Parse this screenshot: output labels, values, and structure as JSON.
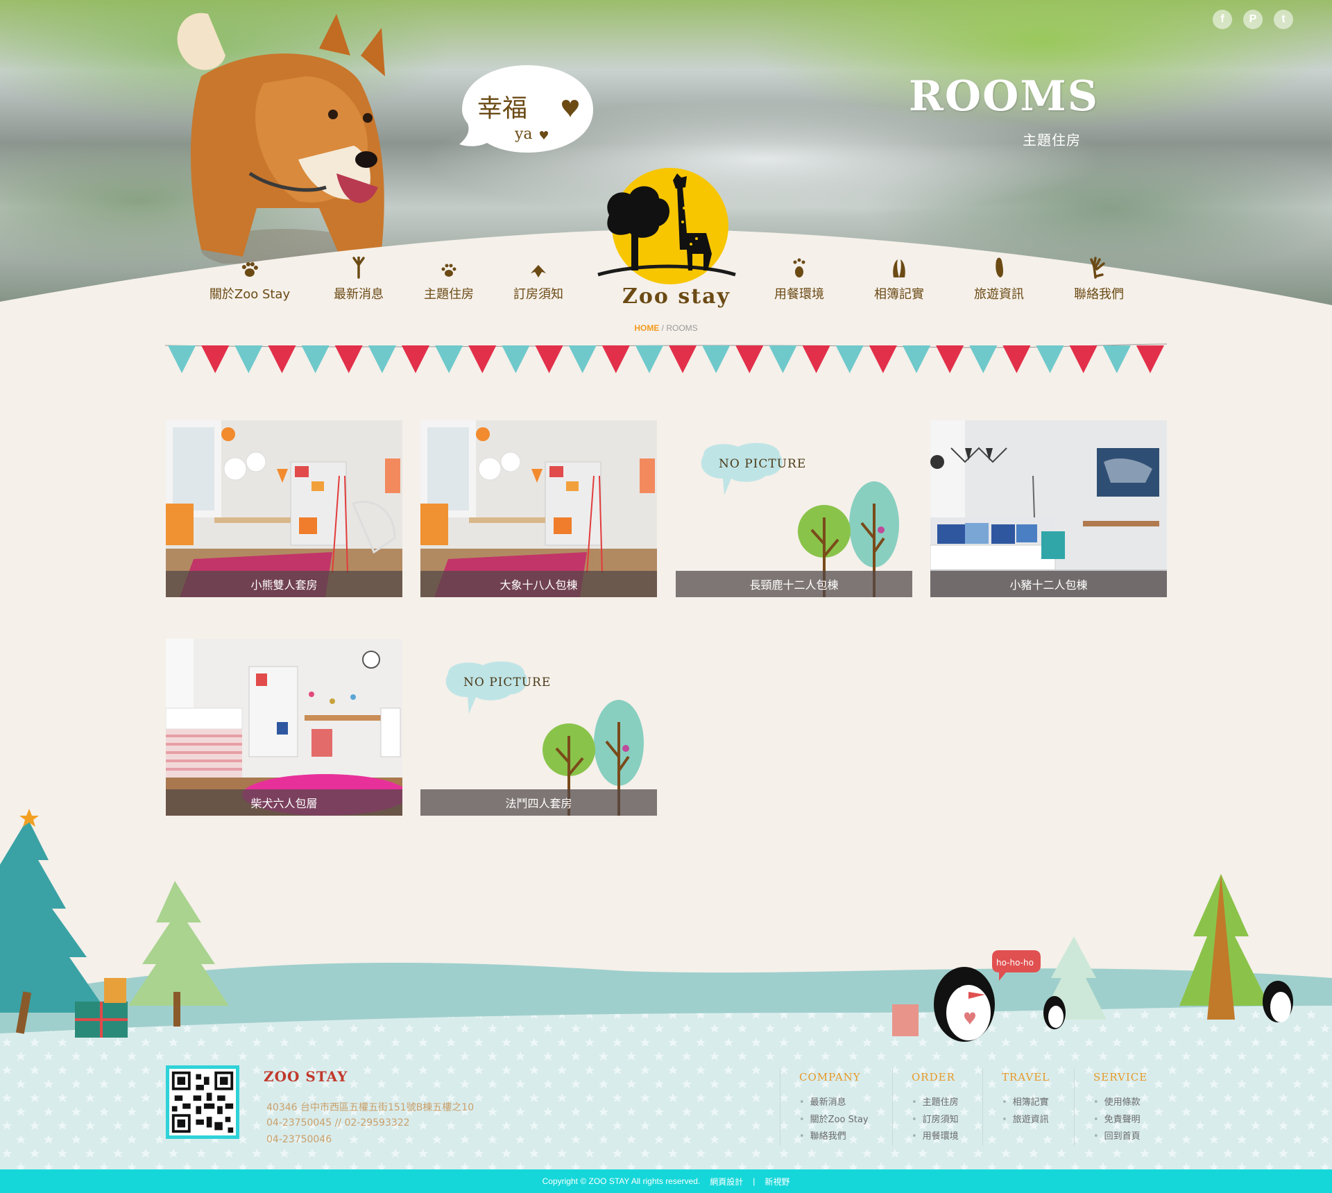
{
  "social": [
    {
      "name": "facebook",
      "icon": "f"
    },
    {
      "name": "plurk",
      "icon": "P"
    },
    {
      "name": "twitter",
      "icon": "t"
    }
  ],
  "hero": {
    "title": "ROOMS",
    "subtitle": "主題住房",
    "bubble_text_main": "幸福",
    "bubble_text_small": "ya"
  },
  "nav": {
    "items": [
      {
        "label": "關於Zoo Stay",
        "icon": "paw-icon"
      },
      {
        "label": "最新消息",
        "icon": "bird-foot-icon"
      },
      {
        "label": "主題住房",
        "icon": "cat-paw-icon"
      },
      {
        "label": "訂房須知",
        "icon": "duck-foot-icon"
      },
      {
        "label": "用餐環境",
        "icon": "bear-paw-icon"
      },
      {
        "label": "相簿記實",
        "icon": "hoof-icon"
      },
      {
        "label": "旅遊資訊",
        "icon": "footprint-icon"
      },
      {
        "label": "聯絡我們",
        "icon": "hand-paw-icon"
      }
    ],
    "logo_text": "Zoo stay"
  },
  "breadcrumb": {
    "home": "HOME",
    "separator": "/",
    "current": "ROOMS"
  },
  "rooms": [
    {
      "name": "小熊雙人套房",
      "image": "photo-bedroom-orange"
    },
    {
      "name": "大象十八人包棟",
      "image": "photo-bedroom-orange"
    },
    {
      "name": "長頸鹿十二人包棟",
      "image": "no-picture"
    },
    {
      "name": "小豬十二人包棟",
      "image": "photo-bedroom-blue"
    },
    {
      "name": "柴犬六人包層",
      "image": "photo-bedroom-pink"
    },
    {
      "name": "法鬥四人套房",
      "image": "no-picture"
    }
  ],
  "no_picture_label": "NO PICTURE",
  "footer": {
    "brand": "ZOO STAY",
    "address": "40346 台中市西區五權五街151號B棟五樓之10",
    "phones": "04-23750045 // 02-29593322",
    "fax": "04-23750046",
    "penguin_speech": "ho-ho-ho",
    "columns": [
      {
        "title": "COMPANY",
        "links": [
          "最新消息",
          "關於Zoo Stay",
          "聯絡我們"
        ]
      },
      {
        "title": "ORDER",
        "links": [
          "主題住房",
          "訂房須知",
          "用餐環境"
        ]
      },
      {
        "title": "TRAVEL",
        "links": [
          "相簿記實",
          "旅遊資訊"
        ]
      },
      {
        "title": "SERVICE",
        "links": [
          "使用條款",
          "免責聲明",
          "回到首頁"
        ]
      }
    ],
    "copyright": "Copyright © ZOO STAY All rights reserved.",
    "designer_label": "網頁設計",
    "designer_sep": "|",
    "designer_name": "新視野"
  },
  "colors": {
    "page_bg": "#f5f0ea",
    "nav_text": "#6b4a14",
    "accent_orange": "#f29b1f",
    "brand_red": "#c0392b",
    "copyright_bar": "#15d7d9",
    "logo_yellow": "#f7c600"
  }
}
